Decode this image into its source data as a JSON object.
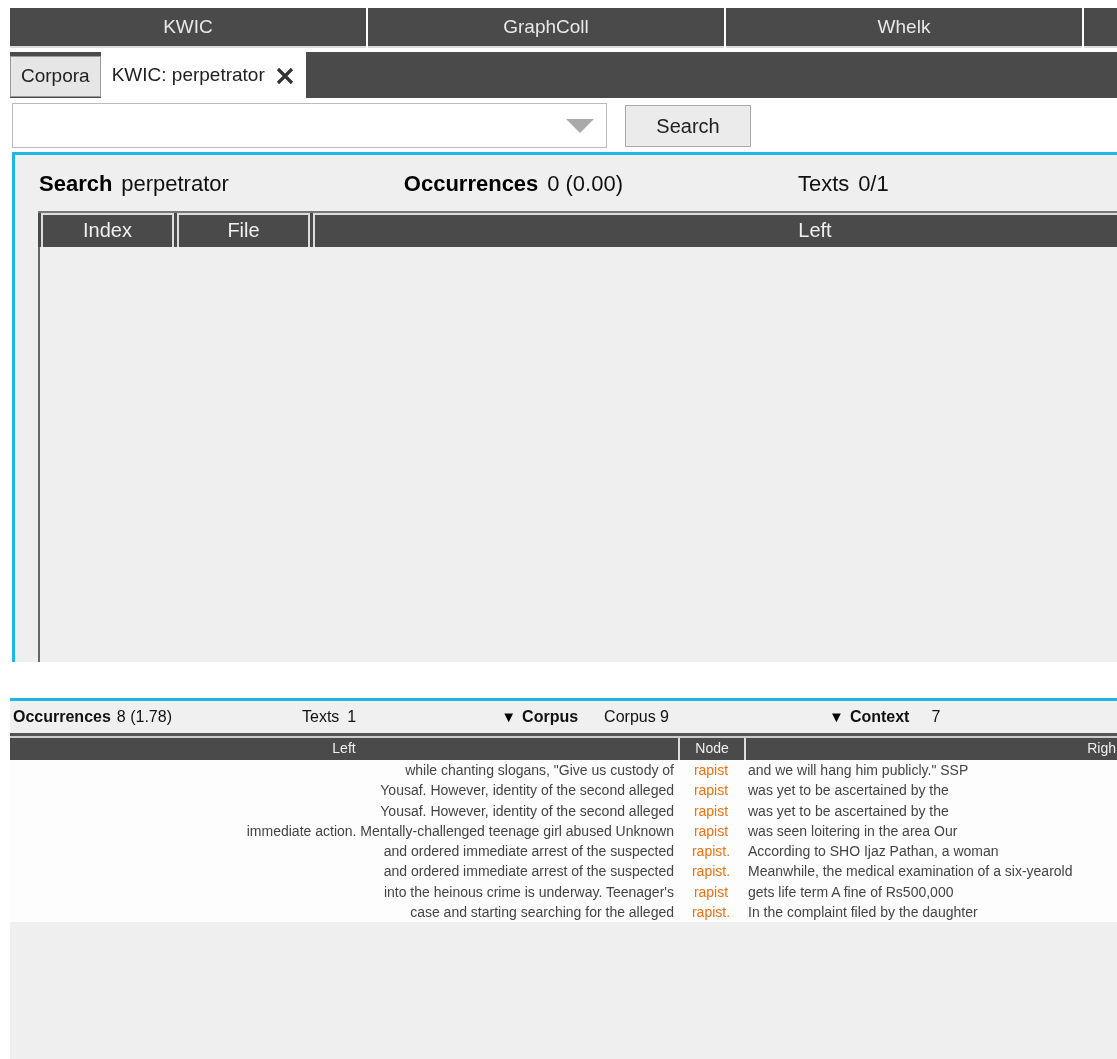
{
  "module_tabs": [
    {
      "label": "KWIC"
    },
    {
      "label": "GraphColl"
    },
    {
      "label": "Whelk"
    }
  ],
  "doc_tabs": [
    {
      "label": "Corpora",
      "selected": false,
      "closable": false
    },
    {
      "label": "KWIC: perpetrator",
      "selected": true,
      "closable": true
    }
  ],
  "search_bar": {
    "button": "Search"
  },
  "top_panel": {
    "search_label": "Search",
    "search_value": "perpetrator",
    "occurrences_label": "Occurrences",
    "occurrences_value": "0 (0.00)",
    "texts_label": "Texts",
    "texts_value": "0/1",
    "columns": [
      "Index",
      "File",
      "Left"
    ]
  },
  "bottom_panel": {
    "occurrences_label": "Occurrences",
    "occurrences_value": "8 (1.78)",
    "texts_label": "Texts",
    "texts_value": "1",
    "corpus_toggle": "▼",
    "corpus_label": "Corpus",
    "corpus_value": "Corpus 9",
    "context_toggle": "▼",
    "context_label": "Context",
    "context_value": "7",
    "columns": [
      "Left",
      "Node",
      "Righ"
    ],
    "rows": [
      {
        "left": "while chanting slogans, \"Give us custody of",
        "node": "rapist",
        "right": "and we will hang him publicly.\" SSP"
      },
      {
        "left": "Yousaf. However, identity of the second alleged",
        "node": "rapist",
        "right": "was yet to be ascertained by the"
      },
      {
        "left": "Yousaf. However, identity of the second alleged",
        "node": "rapist",
        "right": "was yet to be ascertained by the"
      },
      {
        "left": "immediate action. Mentally-challenged teenage girl abused Unknown",
        "node": "rapist",
        "right": "was seen loitering in the area Our"
      },
      {
        "left": "and ordered immediate arrest of the suspected",
        "node": "rapist.",
        "right": "According to SHO Ijaz Pathan, a woman"
      },
      {
        "left": "and ordered immediate arrest of the suspected",
        "node": "rapist.",
        "right": "Meanwhile, the medical examination of a six-yearold"
      },
      {
        "left": "into the heinous crime is underway. Teenager's",
        "node": "rapist",
        "right": "gets life term A fine of Rs500,000"
      },
      {
        "left": "case and starting searching for the alleged",
        "node": "rapist.",
        "right": "In the complaint filed by the daughter"
      }
    ]
  }
}
